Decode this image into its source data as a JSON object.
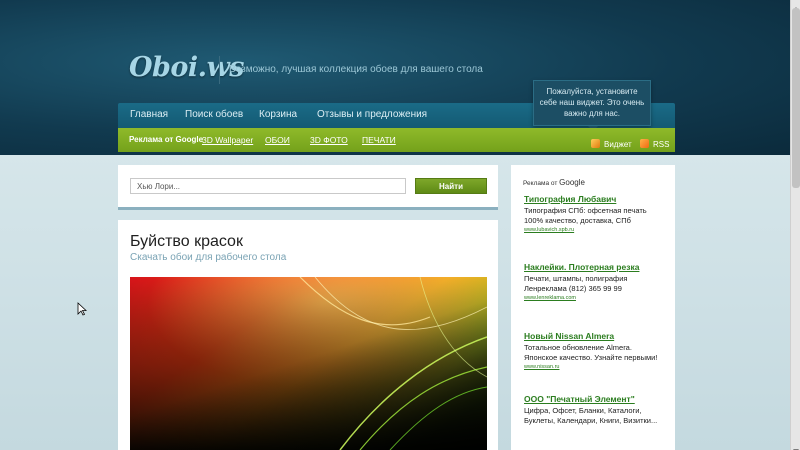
{
  "header": {
    "logo": "Oboi.ws",
    "tagline": "Возможно, лучшая коллекция обоев для вашего стола"
  },
  "nav": {
    "items": [
      {
        "label": "Главная"
      },
      {
        "label": "Поиск обоев"
      },
      {
        "label": "Корзина"
      },
      {
        "label": "Отзывы и предложения"
      }
    ]
  },
  "tooltip": {
    "text": "Пожалуйста, установите себе наш виджет. Это очень важно для нас."
  },
  "subnav": {
    "ads_label": "Реклама от Google",
    "links": [
      "3D Wallpaper",
      "ОБОИ",
      "3D ФОТО",
      "ПЕЧАТИ"
    ],
    "widget_label": "Виджет",
    "rss_label": "RSS"
  },
  "search": {
    "value": "Хью Лори...",
    "button_label": "Найти"
  },
  "content": {
    "title": "Буйство красок",
    "subtitle": "Скачать обои для рабочего стола"
  },
  "sidebar": {
    "ads_prefix": "Реклама от",
    "ads_brand": "Google",
    "ads": [
      {
        "title": "Типография Любавич",
        "body": "Типография СПб: офсетная печать 100% качество, доставка, СПб",
        "url": "www.lubavich.spb.ru"
      },
      {
        "title": "Наклейки. Плотерная резка",
        "body": "Печати, штампы, полиграфия Ленреклама (812) 365 99 99",
        "url": "www.lenreklama.com"
      },
      {
        "title": "Новый Nissan Almera",
        "body": "Тотальное обновление Almera. Японское качество. Узнайте первыми!",
        "url": "www.nissan.ru"
      },
      {
        "title": "ООО \"Печатный Элемент\"",
        "body": "Цифра, Офсет, Бланки, Каталоги, Буклеты, Календари, Книги, Визитки..."
      }
    ]
  },
  "colors": {
    "header_dark": "#113a4f",
    "nav_blue": "#1a6b87",
    "subnav_green": "#7fa822",
    "ad_link_green": "#2b7d1f",
    "subtitle_blue": "#7aa3b4"
  }
}
